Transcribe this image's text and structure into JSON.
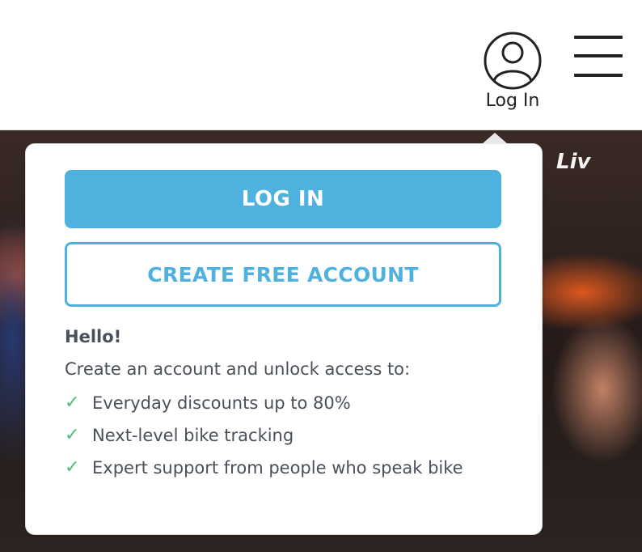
{
  "header": {
    "login_label": "Log In",
    "icons": {
      "user": "user-circle-icon",
      "menu": "hamburger-menu-icon"
    }
  },
  "hero": {
    "brand_mark": "Liv"
  },
  "popover": {
    "login_button": "LOG IN",
    "create_account_button": "CREATE FREE ACCOUNT",
    "greeting": "Hello!",
    "intro": "Create an account and unlock access to:",
    "benefits": [
      {
        "icon": "checkmark-icon",
        "text": "Everyday discounts up to 80%"
      },
      {
        "icon": "checkmark-icon",
        "text": "Next-level bike tracking"
      },
      {
        "icon": "checkmark-icon",
        "text": "Expert support from people who speak bike"
      }
    ],
    "check_glyph": "✓"
  },
  "colors": {
    "accent": "#4fb1de",
    "check": "#4cc07a",
    "text": "#4a5058",
    "header_text": "#222222"
  }
}
